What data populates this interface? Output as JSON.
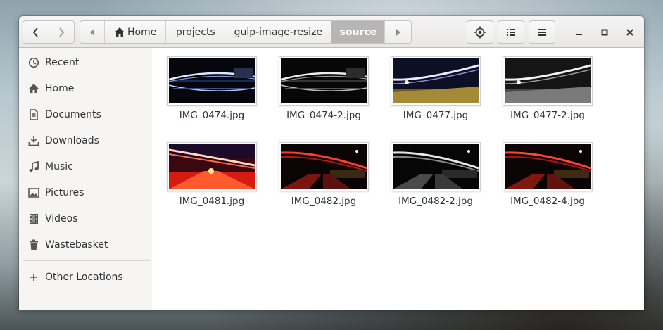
{
  "window": {
    "nav": {
      "back_icon": "chevron-left-icon",
      "forward_icon": "chevron-right-icon"
    },
    "path": {
      "scroll_left_icon": "triangle-left-icon",
      "scroll_right_icon": "triangle-right-icon",
      "home_icon": "home-icon",
      "segments": [
        "Home",
        "projects",
        "gulp-image-resize",
        "source"
      ],
      "active": "source"
    },
    "actions": {
      "location_icon": "crosshair-icon",
      "view_icon": "list-view-icon",
      "menu_icon": "hamburger-menu-icon",
      "minimize_icon": "minimize-icon",
      "maximize_icon": "maximize-icon",
      "close_icon": "close-icon"
    }
  },
  "sidebar": {
    "items": [
      {
        "label": "Recent",
        "icon": "clock-icon"
      },
      {
        "label": "Home",
        "icon": "home-icon"
      },
      {
        "label": "Documents",
        "icon": "document-icon"
      },
      {
        "label": "Downloads",
        "icon": "download-icon"
      },
      {
        "label": "Music",
        "icon": "music-note-icon"
      },
      {
        "label": "Pictures",
        "icon": "picture-icon"
      },
      {
        "label": "Videos",
        "icon": "film-icon"
      },
      {
        "label": "Wastebasket",
        "icon": "trash-icon"
      }
    ],
    "other_locations": {
      "label": "Other Locations",
      "icon": "plus-icon"
    }
  },
  "files": [
    {
      "name": "IMG_0474.jpg",
      "tone": "night-blue"
    },
    {
      "name": "IMG_0474-2.jpg",
      "tone": "night-mono"
    },
    {
      "name": "IMG_0477.jpg",
      "tone": "dusk-gold"
    },
    {
      "name": "IMG_0477-2.jpg",
      "tone": "dusk-mono"
    },
    {
      "name": "IMG_0481.jpg",
      "tone": "red-bright"
    },
    {
      "name": "IMG_0482.jpg",
      "tone": "red-dark"
    },
    {
      "name": "IMG_0482-2.jpg",
      "tone": "mono-dark"
    },
    {
      "name": "IMG_0482-4.jpg",
      "tone": "red-dark-2"
    }
  ]
}
